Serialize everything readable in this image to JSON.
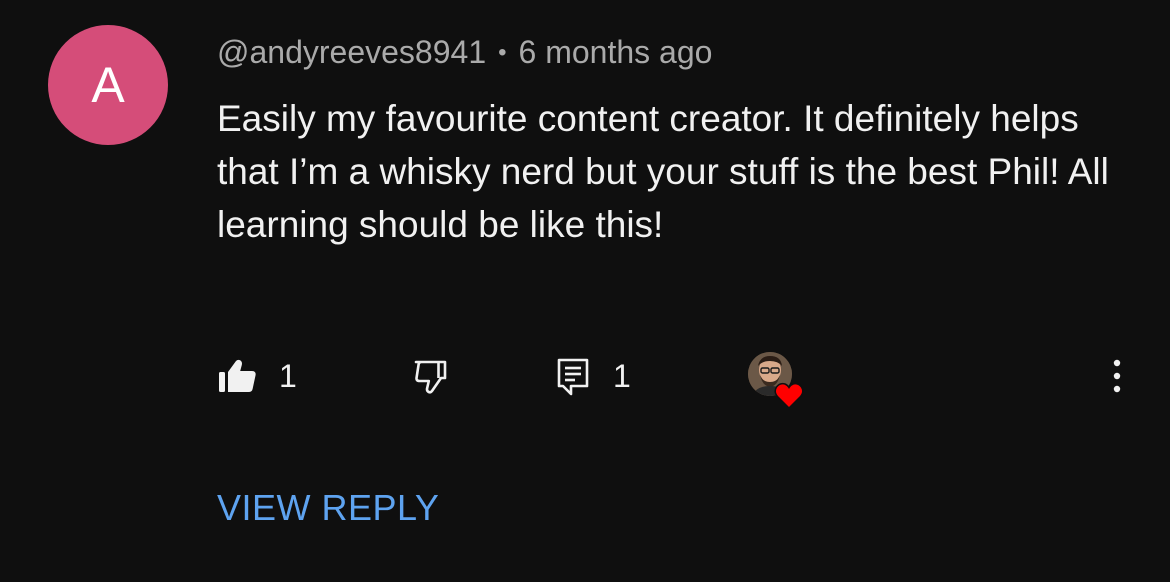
{
  "comment": {
    "avatar_letter": "A",
    "avatar_color": "#d54d79",
    "username": "@andyreeves8941",
    "separator": "•",
    "timestamp": "6 months ago",
    "text": "Easily my favourite content creator. It definitely helps that I’m a whisky nerd but your stuff is the best Phil! All learning should be like this!"
  },
  "actions": {
    "like_count": "1",
    "reply_count": "1",
    "like_icon": "thumbs-up-filled-icon",
    "dislike_icon": "thumbs-down-outline-icon",
    "reply_icon": "comment-reply-icon",
    "heart_icon": "heart-icon",
    "more_icon": "more-vertical-icon",
    "heart_color": "#ff0000"
  },
  "view_reply": {
    "label": "VIEW REPLY",
    "color": "#5ea3f0"
  }
}
